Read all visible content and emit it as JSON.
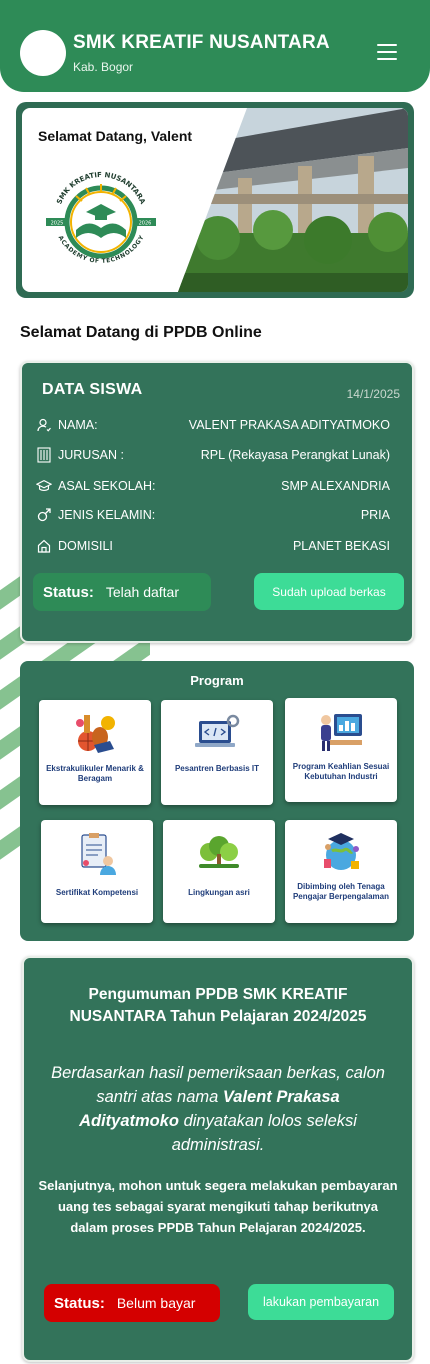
{
  "header": {
    "school_name": "SMK KREATIF NUSANTARA",
    "region": "Kab. Bogor",
    "menu_icon": "hamburger-menu-icon"
  },
  "hero": {
    "greeting": "Selamat Datang, Valent",
    "logo_text_top": "SMK KREATIF NUSANTARA",
    "logo_text_bottom": "ACADEMY OF TECHNOLOGY",
    "logo_year_left": "2025",
    "logo_year_right": "2026"
  },
  "page": {
    "section_title": "Selamat Datang di PPDB Online"
  },
  "student": {
    "title": "DATA SISWA",
    "date": "14/1/2025",
    "rows": [
      {
        "icon": "user-icon",
        "label": "NAMA:",
        "value": "VALENT PRAKASA ADITYATMOKO"
      },
      {
        "icon": "building-icon",
        "label": "JURUSAN :",
        "value": "RPL (Rekayasa Perangkat Lunak)"
      },
      {
        "icon": "graduation-cap-icon",
        "label": "ASAL SEKOLAH:",
        "value": "SMP ALEXANDRIA"
      },
      {
        "icon": "male-icon",
        "label": "JENIS KELAMIN:",
        "value": "PRIA"
      },
      {
        "icon": "home-icon",
        "label": "DOMISILI",
        "value": "PLANET BEKASI"
      }
    ],
    "status_label": "Status:",
    "status_value": "Telah daftar",
    "upload_button": "Sudah upload berkas"
  },
  "program": {
    "title": "Program",
    "items": [
      {
        "icon": "extracurricular-icon",
        "label": "Ekstrakulikuler Menarik & Beragam"
      },
      {
        "icon": "computer-code-icon",
        "label": "Pesantren Berbasis IT"
      },
      {
        "icon": "industry-skill-icon",
        "label": "Program Keahlian Sesuai Kebutuhan Industri"
      },
      {
        "icon": "certificate-icon",
        "label": "Sertifikat Kompetensi"
      },
      {
        "icon": "nature-icon",
        "label": "Lingkungan asri"
      },
      {
        "icon": "teacher-icon",
        "label": "Dibimbing oleh Tenaga Pengajar Berpengalaman"
      }
    ]
  },
  "announcement": {
    "title": "Pengumuman PPDB SMK KREATIF NUSANTARA Tahun Pelajaran 2024/2025",
    "verdict_prefix": "Berdasarkan hasil pemeriksaan berkas, calon santri atas nama ",
    "verdict_name": "Valent Prakasa Adityatmoko",
    "verdict_suffix": " dinyatakan lolos seleksi administrasi.",
    "next_step": "Selanjutnya, mohon untuk segera melakukan pembayaran uang tes sebagai syarat mengikuti tahap berikutnya dalam proses PPDB Tahun Pelajaran 2024/2025.",
    "status_label": "Status:",
    "status_value": "Belum bayar",
    "pay_button": "lakukan pembayaran"
  },
  "colors": {
    "primary_green": "#2e8b57",
    "card_green": "#33735a",
    "accent_mint": "#3ddc97",
    "alert_red": "#d40000"
  }
}
